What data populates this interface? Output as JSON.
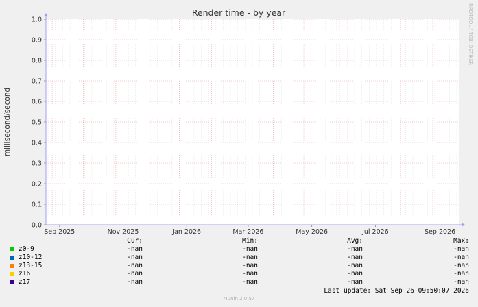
{
  "watermark": "RRDTOOL / TOBI OETIKER",
  "footer": "Munin 2.0.57",
  "last_update": "Last update: Sat Sep 26 09:50:07 2026",
  "legend": {
    "headers": {
      "cur": "Cur:",
      "min": "Min:",
      "avg": "Avg:",
      "max": "Max:"
    },
    "rows": [
      {
        "name": "z0-9",
        "color": "#00cc00",
        "cur": "-nan",
        "min": "-nan",
        "avg": "-nan",
        "max": "-nan"
      },
      {
        "name": "z10-12",
        "color": "#0066b3",
        "cur": "-nan",
        "min": "-nan",
        "avg": "-nan",
        "max": "-nan"
      },
      {
        "name": "z13-15",
        "color": "#ff8000",
        "cur": "-nan",
        "min": "-nan",
        "avg": "-nan",
        "max": "-nan"
      },
      {
        "name": "z16",
        "color": "#ffcc00",
        "cur": "-nan",
        "min": "-nan",
        "avg": "-nan",
        "max": "-nan"
      },
      {
        "name": "z17",
        "color": "#330099",
        "cur": "-nan",
        "min": "-nan",
        "avg": "-nan",
        "max": "-nan"
      }
    ]
  },
  "chart_data": {
    "type": "line",
    "title": "Render time - by year",
    "ylabel": "millisecond/second",
    "xlabel": "",
    "ylim": [
      0,
      1.0
    ],
    "y_ticks": [
      "0.0",
      "0.1",
      "0.2",
      "0.3",
      "0.4",
      "0.5",
      "0.6",
      "0.7",
      "0.8",
      "0.9",
      "1.0"
    ],
    "xlim": [
      "2025-08-26",
      "2026-09-26"
    ],
    "x_ticks": [
      {
        "label": "Sep 2025",
        "date": "2025-09-08"
      },
      {
        "label": "Nov 2025",
        "date": "2025-11-08"
      },
      {
        "label": "Jan 2026",
        "date": "2026-01-08"
      },
      {
        "label": "Mar 2026",
        "date": "2026-03-08"
      },
      {
        "label": "May 2026",
        "date": "2026-05-08"
      },
      {
        "label": "Jul 2026",
        "date": "2026-07-08"
      },
      {
        "label": "Sep 2026",
        "date": "2026-09-08"
      }
    ],
    "month_gridlines": [
      "2025-09-01",
      "2025-10-01",
      "2025-11-01",
      "2025-12-01",
      "2026-01-01",
      "2026-02-01",
      "2026-03-01",
      "2026-04-01",
      "2026-05-01",
      "2026-06-01",
      "2026-07-01",
      "2026-08-01",
      "2026-09-01"
    ],
    "grid": true,
    "series": [
      {
        "name": "z0-9",
        "values": []
      },
      {
        "name": "z10-12",
        "values": []
      },
      {
        "name": "z13-15",
        "values": []
      },
      {
        "name": "z16",
        "values": []
      },
      {
        "name": "z17",
        "values": []
      }
    ],
    "colors": {
      "background": "#f0f0f0",
      "plot": "#ffffff",
      "major_grid": "#e8a0a0",
      "minor_grid": "#dddddd",
      "axis": "#a0a0f0"
    }
  }
}
